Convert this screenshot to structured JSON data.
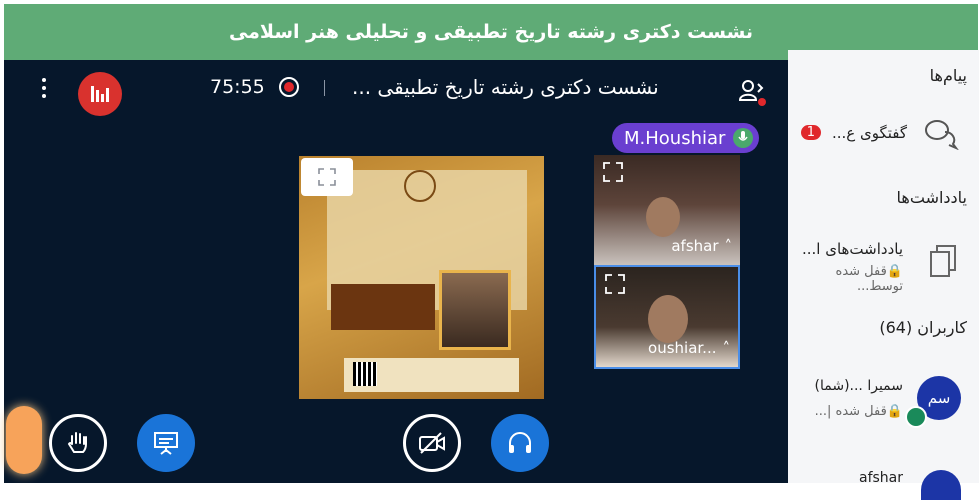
{
  "banner_title": "نشست دکتری رشته تاریخ تطبیقی و تحلیلی هنر اسلامی",
  "meeting": {
    "title": "نشست دکتری رشته تاریخ تطبیقی ...",
    "timer": "75:55"
  },
  "talking": {
    "name": "M.Houshiar"
  },
  "videos": [
    {
      "name": "afshar"
    },
    {
      "name": "oushiar..."
    }
  ],
  "sidebar": {
    "messages_heading": "پیام‌ها",
    "chat_label": "گفتگوی ع...",
    "chat_badge": "1",
    "notes_heading": "یادداشت‌ها",
    "note_title": "یادداشت‌های ا...",
    "note_status": "قفل شده توسط...",
    "users_heading": "کاربران (64)",
    "users": [
      {
        "avatar": "سم",
        "name": "سمیرا ...(شما)",
        "status": "قفل شده |..."
      },
      {
        "name": "afshar"
      }
    ]
  },
  "colors": {
    "banner": "#5fab76",
    "main_bg": "#06172b",
    "accent_blue": "#1a74d8",
    "talk_pill": "#6a3fd0",
    "record_red": "#d9322e"
  }
}
